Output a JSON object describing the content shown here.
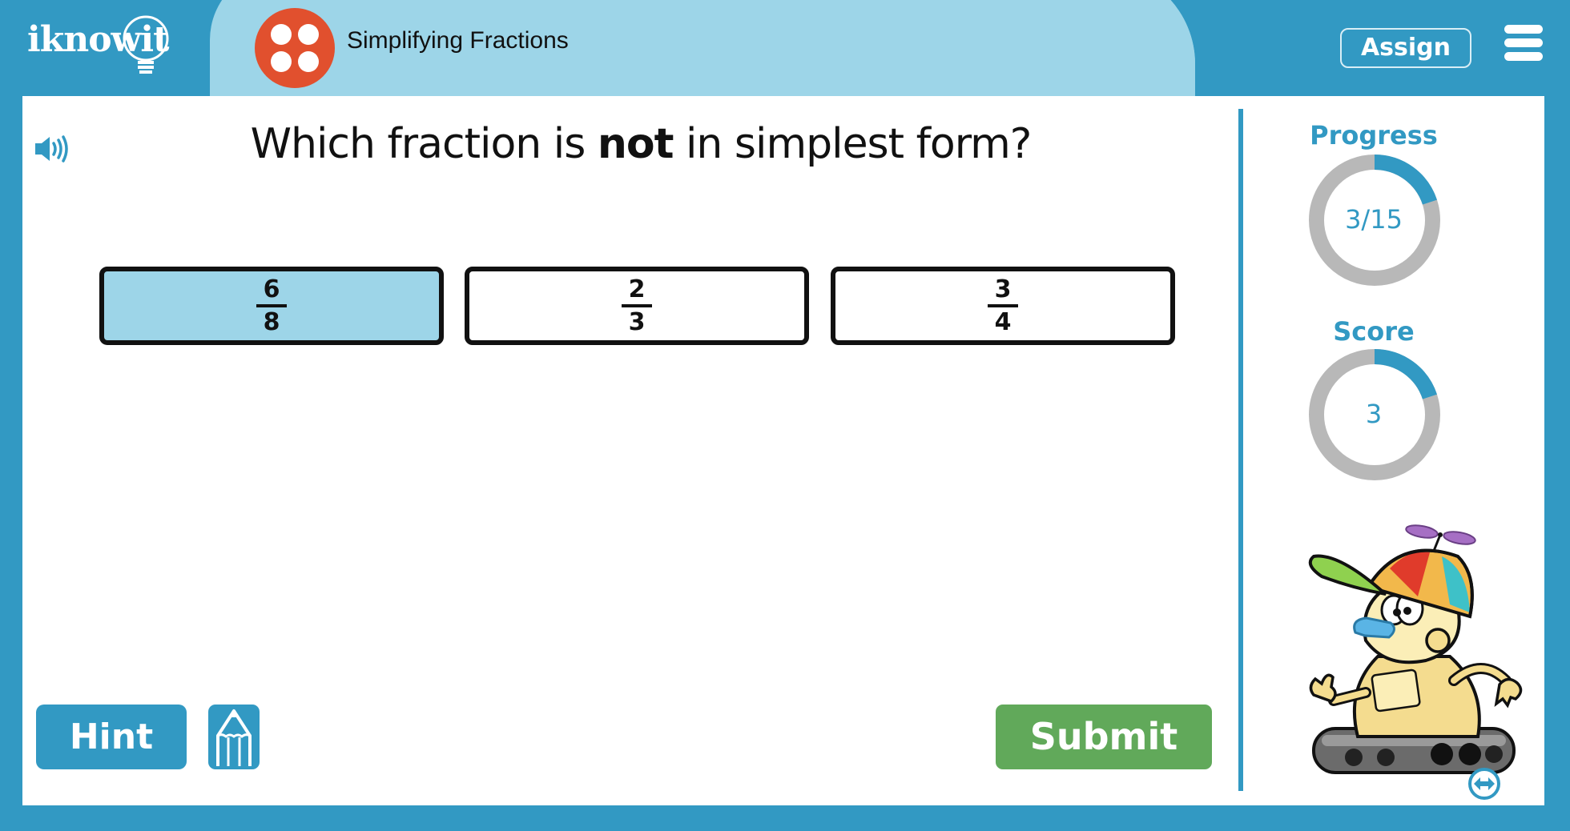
{
  "header": {
    "logo_text": "iknowit",
    "topic_title": "Simplifying Fractions",
    "assign_label": "Assign",
    "colors": {
      "bar": "#3299c3",
      "pill": "#9dd5e8",
      "topic_icon": "#e1502e"
    }
  },
  "question": {
    "prefix": "Which fraction is ",
    "emphasis": "not",
    "suffix": " in simplest form?"
  },
  "choices": [
    {
      "numerator": "6",
      "denominator": "8",
      "selected": true
    },
    {
      "numerator": "2",
      "denominator": "3",
      "selected": false
    },
    {
      "numerator": "3",
      "denominator": "4",
      "selected": false
    }
  ],
  "sidebar": {
    "progress_label": "Progress",
    "progress_text": "3/15",
    "progress_fraction": 0.2,
    "score_label": "Score",
    "score_text": "3",
    "score_fraction": 0.2
  },
  "buttons": {
    "hint_label": "Hint",
    "submit_label": "Submit"
  },
  "icons": {
    "speaker": "speaker-icon",
    "menu": "hamburger-menu-icon",
    "pencil": "pencil-icon",
    "swap": "swap-arrows-icon",
    "mascot": "robot-mascot"
  },
  "colors": {
    "accent": "#3299c3",
    "selected_choice": "#9dd5e8",
    "submit": "#61a95a",
    "ring_track": "#b8b8b8"
  }
}
